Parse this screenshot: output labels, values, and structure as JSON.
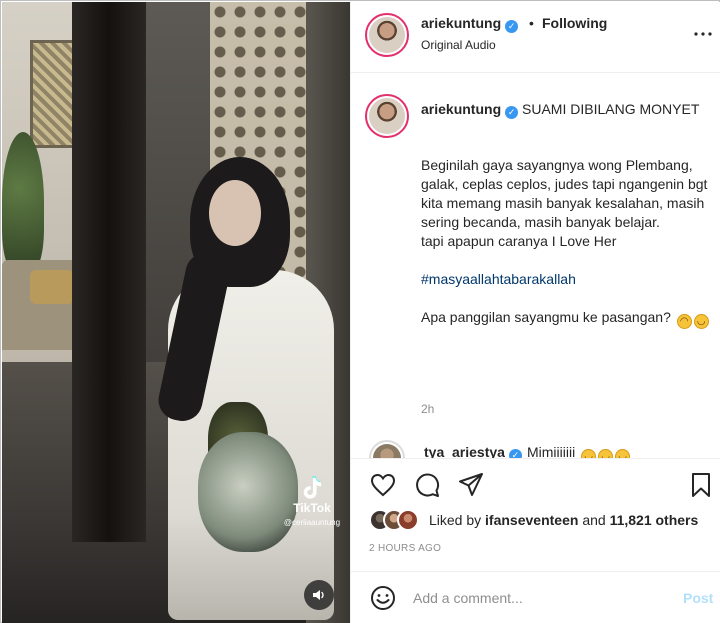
{
  "video": {
    "watermark_label": "TikTok",
    "watermark_handle": "@ceriiaauntung"
  },
  "header": {
    "username": "ariekuntung",
    "separator": "•",
    "follow_status": "Following",
    "audio": "Original Audio"
  },
  "caption": {
    "username": "ariekuntung",
    "title": "SUAMI DIBILANG MONYET",
    "lines": [
      "Beginilah gaya sayangnya wong Plembang, galak, ceplas ceplos, judes tapi ngangenin bgt",
      "kita memang masih banyak kesalahan, masih sering becanda, masih banyak belajar.",
      "tapi apapun caranya I Love Her"
    ],
    "hashtag": "#masyaallahtabarakallah",
    "question": "Apa panggilan sayangmu ke pasangan?",
    "time": "2h"
  },
  "comment_preview": {
    "username": "tya_ariestya",
    "text": "Mimiiiiiii"
  },
  "actions": {
    "liked_by_prefix": "Liked by",
    "liked_by_user": "ifanseventeen",
    "liked_by_joiner": "and",
    "liked_by_count": "11,821 others",
    "posted_time": "2 HOURS AGO"
  },
  "comment_box": {
    "placeholder": "Add a comment...",
    "post_label": "Post"
  },
  "colors": {
    "verified": "#3897f0",
    "link": "#00376b",
    "muted": "#8e8e8e",
    "post_disabled": "#b2dffc",
    "story_ring": "#e1306c"
  },
  "icons": [
    "verified-badge-icon",
    "more-options-icon",
    "heart-icon",
    "comment-icon",
    "share-icon",
    "bookmark-icon",
    "emoji-icon",
    "sound-icon",
    "tiktok-logo-icon"
  ]
}
